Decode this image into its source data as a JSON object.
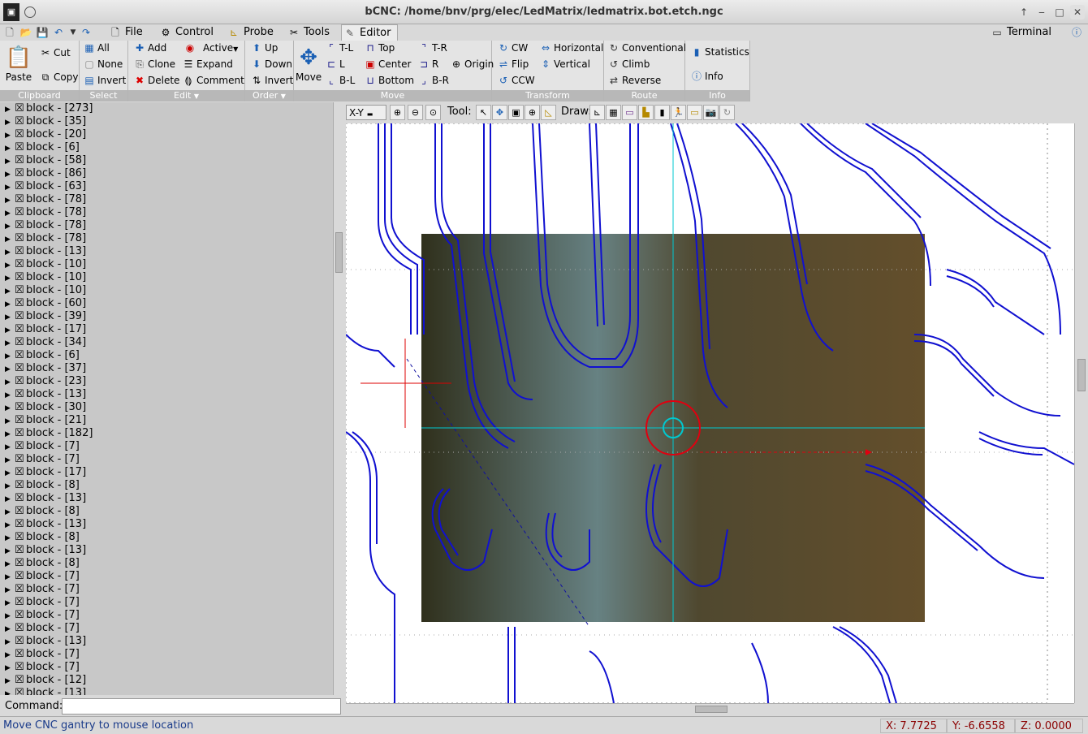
{
  "window": {
    "title": "bCNC: /home/bnv/prg/elec/LedMatrix/ledmatrix.bot.etch.ngc"
  },
  "tabs": [
    {
      "label": "File",
      "icon": "file-icon"
    },
    {
      "label": "Control",
      "icon": "control-icon"
    },
    {
      "label": "Probe",
      "icon": "probe-icon"
    },
    {
      "label": "Tools",
      "icon": "tools-icon"
    },
    {
      "label": "Editor",
      "icon": "editor-icon"
    }
  ],
  "terminal_tab": "Terminal",
  "ribbon": {
    "clipboard": {
      "label": "Clipboard",
      "paste": "Paste",
      "cut": "Cut",
      "copy": "Copy"
    },
    "select": {
      "label": "Select",
      "all": "All",
      "none": "None",
      "invert": "Invert"
    },
    "edit": {
      "label": "Edit",
      "add": "Add",
      "clone": "Clone",
      "delete": "Delete",
      "active": "Active",
      "expand": "Expand",
      "comment": "Comment"
    },
    "order": {
      "label": "Order",
      "up": "Up",
      "down": "Down",
      "invert": "Invert"
    },
    "move": {
      "label": "Move",
      "move": "Move",
      "tl": "T-L",
      "l": "L",
      "bl": "B-L",
      "top": "Top",
      "center": "Center",
      "bottom": "Bottom",
      "tr": "T-R",
      "r": "R",
      "br": "B-R",
      "origin": "Origin"
    },
    "transform": {
      "label": "Transform",
      "cw": "CW",
      "flip": "Flip",
      "ccw": "CCW",
      "horizontal": "Horizontal",
      "vertical": "Vertical"
    },
    "route": {
      "label": "Route",
      "conventional": "Conventional",
      "climb": "Climb",
      "reverse": "Reverse"
    },
    "info": {
      "label": "Info",
      "statistics": "Statistics",
      "info": "Info"
    }
  },
  "blocks": [
    "block - [273]",
    "block - [35]",
    "block - [20]",
    "block - [6]",
    "block - [58]",
    "block - [86]",
    "block - [63]",
    "block - [78]",
    "block - [78]",
    "block - [78]",
    "block - [78]",
    "block - [13]",
    "block - [10]",
    "block - [10]",
    "block - [10]",
    "block - [60]",
    "block - [39]",
    "block - [17]",
    "block - [34]",
    "block - [6]",
    "block - [37]",
    "block - [23]",
    "block - [13]",
    "block - [30]",
    "block - [21]",
    "block - [182]",
    "block - [7]",
    "block - [7]",
    "block - [17]",
    "block - [8]",
    "block - [13]",
    "block - [8]",
    "block - [13]",
    "block - [8]",
    "block - [13]",
    "block - [8]",
    "block - [7]",
    "block - [7]",
    "block - [7]",
    "block - [7]",
    "block - [7]",
    "block - [13]",
    "block - [7]",
    "block - [7]",
    "block - [12]",
    "block - [13]"
  ],
  "command": {
    "label": "Command:",
    "value": ""
  },
  "canvas_toolbar": {
    "view": "X-Y",
    "tool_label": "Tool:",
    "draw_label": "Draw:"
  },
  "status": {
    "message": "Move CNC gantry to mouse location",
    "x": "X: 7.7725",
    "y": "Y: -6.6558",
    "z": "Z: 0.0000"
  }
}
